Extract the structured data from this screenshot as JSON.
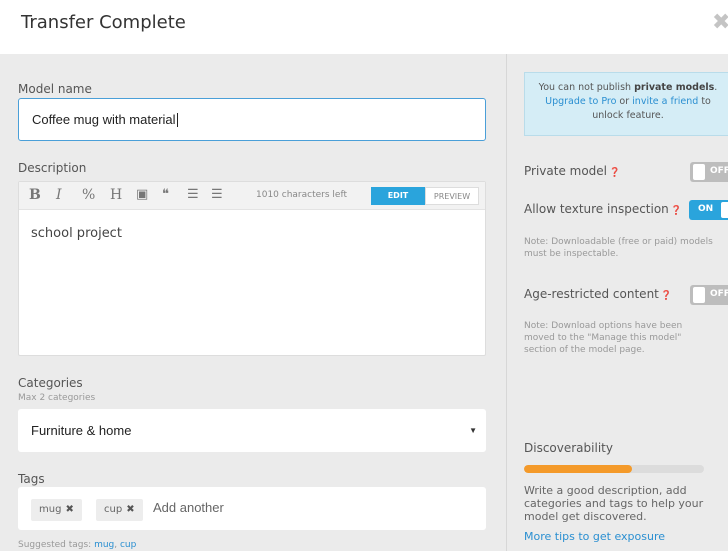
{
  "dialog": {
    "title": "Transfer Complete",
    "close_glyph": "✖"
  },
  "model_name": {
    "label": "Model name",
    "value": "Coffee mug with material"
  },
  "description": {
    "label": "Description",
    "toolbar": {
      "bold": "B",
      "italic": "I",
      "link": "%",
      "heading": "H",
      "image": "▣",
      "quote": "❝",
      "ordered_list": "☰",
      "unordered_list": "☰"
    },
    "chars_left": "1010 characters left",
    "edit_label": "EDIT",
    "preview_label": "PREVIEW",
    "content": "school project"
  },
  "categories": {
    "label": "Categories",
    "hint": "Max 2 categories",
    "selected": "Furniture & home"
  },
  "tags": {
    "label": "Tags",
    "items": [
      "mug",
      "cup"
    ],
    "remove_glyph": "✖",
    "placeholder": "Add another",
    "suggested_prefix": "Suggested tags:",
    "suggested": [
      "mug",
      "cup"
    ]
  },
  "notice": {
    "text1": "You can not publish ",
    "bold": "private models",
    "text2": ".",
    "link1": "Upgrade to Pro",
    "text3": " or ",
    "link2": "invite a friend",
    "text4": " to unlock feature."
  },
  "options": {
    "private_model": {
      "label": "Private model",
      "state": "OFF",
      "on": false
    },
    "texture_inspection": {
      "label": "Allow texture inspection",
      "state": "ON",
      "on": true
    },
    "texture_note": "Note: Downloadable (free or paid) models must be inspectable.",
    "age_restricted": {
      "label": "Age-restricted content",
      "state": "OFF",
      "on": false
    },
    "download_note": "Note: Download options have been moved to the \"Manage this model\" section of the model page."
  },
  "discoverability": {
    "label": "Discoverability",
    "progress": 0.6,
    "description": "Write a good description, add categories and tags to help your model get discovered.",
    "link": "More tips to get exposure"
  },
  "colors": {
    "accent": "#2aa4dc",
    "progress": "#f49a2a",
    "link": "#2a8fd1"
  }
}
